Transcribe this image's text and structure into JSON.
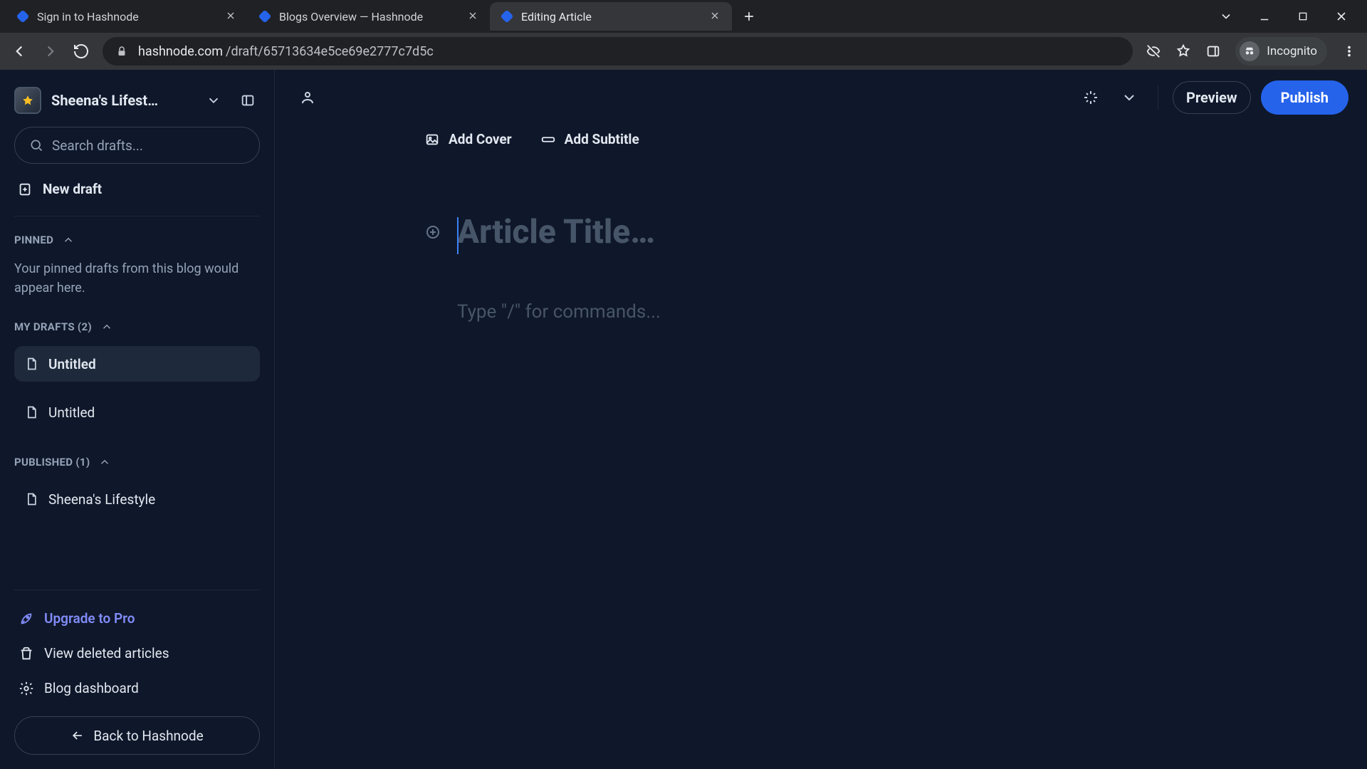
{
  "browser": {
    "tabs": [
      {
        "label": "Sign in to Hashnode",
        "active": false
      },
      {
        "label": "Blogs Overview — Hashnode",
        "active": false
      },
      {
        "label": "Editing Article",
        "active": true
      }
    ],
    "url_host": "hashnode.com",
    "url_path": "/draft/65713634e5ce69e2777c7d5c",
    "incognito_label": "Incognito"
  },
  "sidebar": {
    "blog_name": "Sheena's Lifest…",
    "search_placeholder": "Search drafts...",
    "new_draft_label": "New draft",
    "sections": {
      "pinned_label": "PINNED",
      "pinned_empty": "Your pinned drafts from this blog would appear here.",
      "drafts_label": "MY DRAFTS (2)",
      "drafts": [
        {
          "title": "Untitled",
          "active": true
        },
        {
          "title": "Untitled",
          "active": false
        }
      ],
      "published_label": "PUBLISHED (1)",
      "published": [
        {
          "title": "Sheena's Lifestyle"
        }
      ]
    },
    "upgrade_label": "Upgrade to Pro",
    "deleted_label": "View deleted articles",
    "dashboard_label": "Blog dashboard",
    "back_label": "Back to Hashnode"
  },
  "topbar": {
    "preview_label": "Preview",
    "publish_label": "Publish"
  },
  "editor": {
    "add_cover_label": "Add Cover",
    "add_subtitle_label": "Add Subtitle",
    "title_placeholder": "Article Title…",
    "body_placeholder": "Type \"/\" for commands..."
  }
}
